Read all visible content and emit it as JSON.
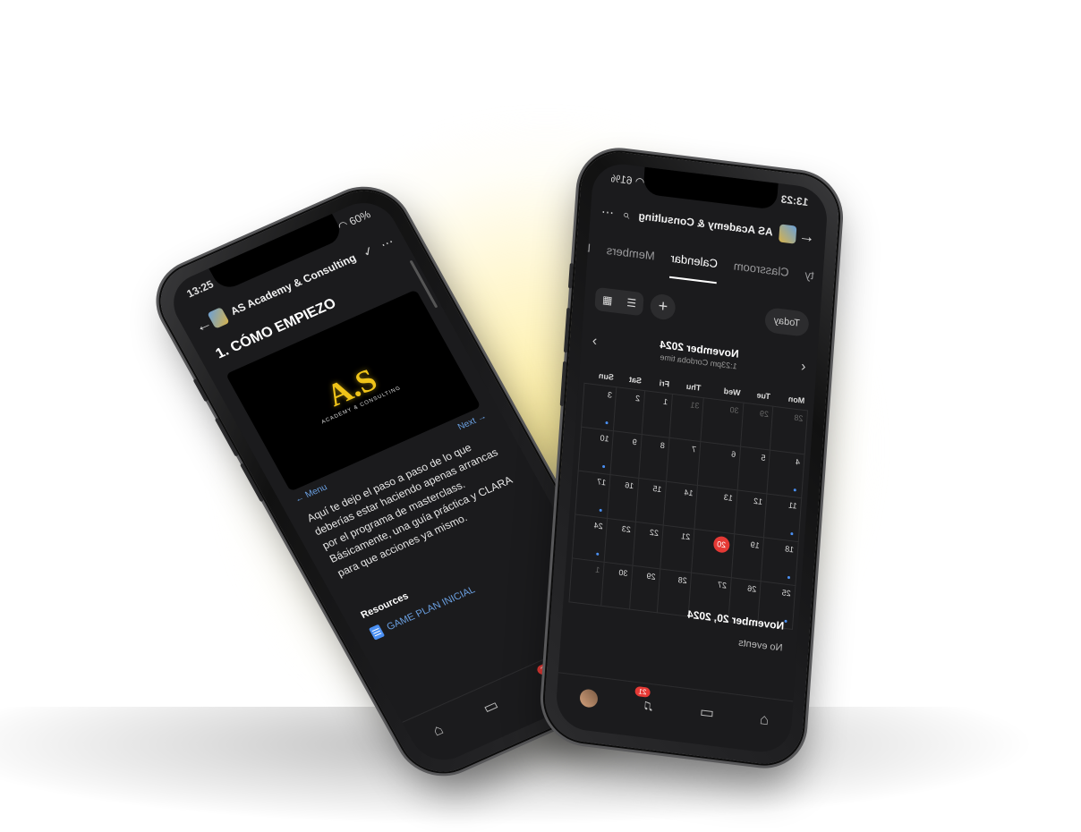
{
  "phone_left": {
    "status": {
      "time": "13:25",
      "battery": "60%"
    },
    "header": {
      "title": "AS Academy & Consulting"
    },
    "lesson": {
      "title": "1. CÓMO EMPIEZO",
      "video_brand": "A.S",
      "video_brand_sub": "ACADEMY & CONSULTING",
      "nav_menu": "← Menu",
      "nav_next": "Next →",
      "body": "Aquí te dejo el paso a paso de lo que deberías estar haciendo apenas arrancas por el programa de masterclass. Básicamente, una guía práctica y CLARA para que acciones ya mismo."
    },
    "resources": {
      "title": "Resources",
      "items": [
        "GAME PLAN INICIAL"
      ]
    },
    "nav": {
      "notifications_count": "21"
    }
  },
  "phone_right": {
    "status": {
      "time": "13:23",
      "battery": "61%"
    },
    "header": {
      "title": "AS Academy & Consulting"
    },
    "tabs": [
      "ty",
      "Classroom",
      "Calendar",
      "Members",
      "Leaderb"
    ],
    "active_tab": "Calendar",
    "toolbar": {
      "today": "Today"
    },
    "calendar": {
      "month": "November 2024",
      "timezone": "1:23pm Cordoba time",
      "weekdays": [
        "Mon",
        "Tue",
        "Wed",
        "Thu",
        "Fri",
        "Sat",
        "Sun"
      ],
      "weeks": [
        [
          "28",
          "29",
          "30",
          "31",
          "1",
          "2",
          "3"
        ],
        [
          "4",
          "5",
          "6",
          "7",
          "8",
          "9",
          "10"
        ],
        [
          "11",
          "12",
          "13",
          "14",
          "15",
          "16",
          "17"
        ],
        [
          "18",
          "19",
          "20",
          "21",
          "22",
          "23",
          "24"
        ],
        [
          "25",
          "26",
          "27",
          "28",
          "29",
          "30",
          "1"
        ]
      ],
      "today": "20"
    },
    "selected_day": "November 20, 2024",
    "events_text": "No events",
    "nav": {
      "notifications_count": "21"
    }
  }
}
